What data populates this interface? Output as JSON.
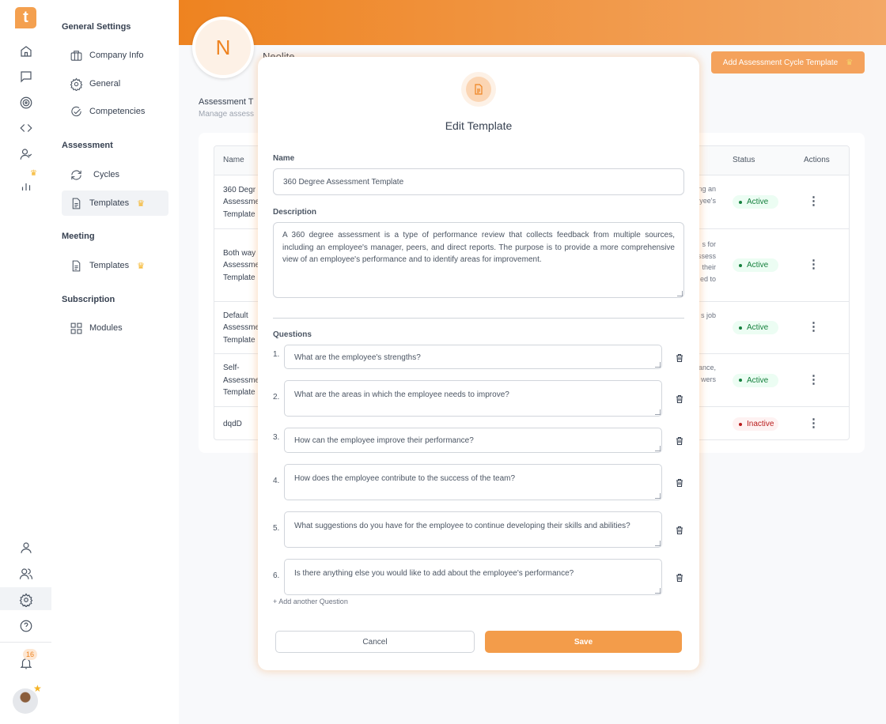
{
  "colors": {
    "accent": "#ee8320",
    "button": "#f4a25c",
    "active": "#15803d",
    "inactive": "#b91c1c"
  },
  "rail": {
    "logo": "t",
    "top_icons": [
      "home-icon",
      "chat-icon",
      "target-icon",
      "code-icon",
      "user-check-icon",
      "bar-chart-icon"
    ],
    "bottom_icons": [
      "user-icon",
      "users-icon",
      "gear-icon",
      "help-icon"
    ],
    "notifications": "16"
  },
  "nav": {
    "sections": [
      {
        "title": "General Settings",
        "items": [
          {
            "label": "Company Info"
          },
          {
            "label": "General"
          },
          {
            "label": "Competencies"
          }
        ]
      },
      {
        "title": "Assessment",
        "items": [
          {
            "label": "Cycles"
          },
          {
            "label": "Templates",
            "active": true,
            "premium": true
          }
        ]
      },
      {
        "title": "Meeting",
        "items": [
          {
            "label": "Templates",
            "premium": true
          }
        ]
      },
      {
        "title": "Subscription",
        "items": [
          {
            "label": "Modules"
          }
        ]
      }
    ]
  },
  "header": {
    "avatar_letter": "N",
    "company": "Neolite",
    "add_button": "Add Assessment Cycle Template"
  },
  "page": {
    "title": "Assessment T",
    "subtitle": "Manage assess"
  },
  "table": {
    "columns": {
      "name": "Name",
      "status": "Status",
      "actions": "Actions"
    },
    "rows": [
      {
        "name": [
          "360 Degr",
          "Assessme",
          "Template"
        ],
        "desc": [
          "ng an",
          "yee's"
        ],
        "status": "Active"
      },
      {
        "name": [
          "Both way",
          "Assessme",
          "Template"
        ],
        "desc": [
          "s  for",
          "ssess",
          "their",
          "ed to"
        ],
        "status": "Active"
      },
      {
        "name": [
          "Default",
          "Assessme",
          "Template"
        ],
        "desc": [
          "s job"
        ],
        "status": "Active"
      },
      {
        "name": [
          "Self-",
          "Assessme",
          "Template"
        ],
        "desc": [
          "ance,",
          "wers"
        ],
        "status": "Active"
      },
      {
        "name": [
          "dqdD"
        ],
        "desc": [],
        "status": "Inactive"
      }
    ]
  },
  "modal": {
    "title": "Edit Template",
    "name_label": "Name",
    "name_value": "360 Degree Assessment Template",
    "description_label": "Description",
    "description_value": "A 360 degree assessment is a type of performance review that collects feedback from multiple sources, including an employee's manager, peers, and direct reports. The purpose is to provide a more comprehensive view of an employee's performance and to identify areas for improvement.",
    "questions_label": "Questions",
    "questions": [
      "What are the employee's strengths?",
      "What are the areas in which the employee needs to improve?",
      "How can the employee improve their performance?",
      "How does the employee contribute to the success of the team?",
      "What suggestions do you have for the employee to continue developing their skills and abilities?",
      "Is there anything else you would like to add about the employee's performance?"
    ],
    "add_question": "+ Add another Question",
    "cancel": "Cancel",
    "save": "Save"
  }
}
